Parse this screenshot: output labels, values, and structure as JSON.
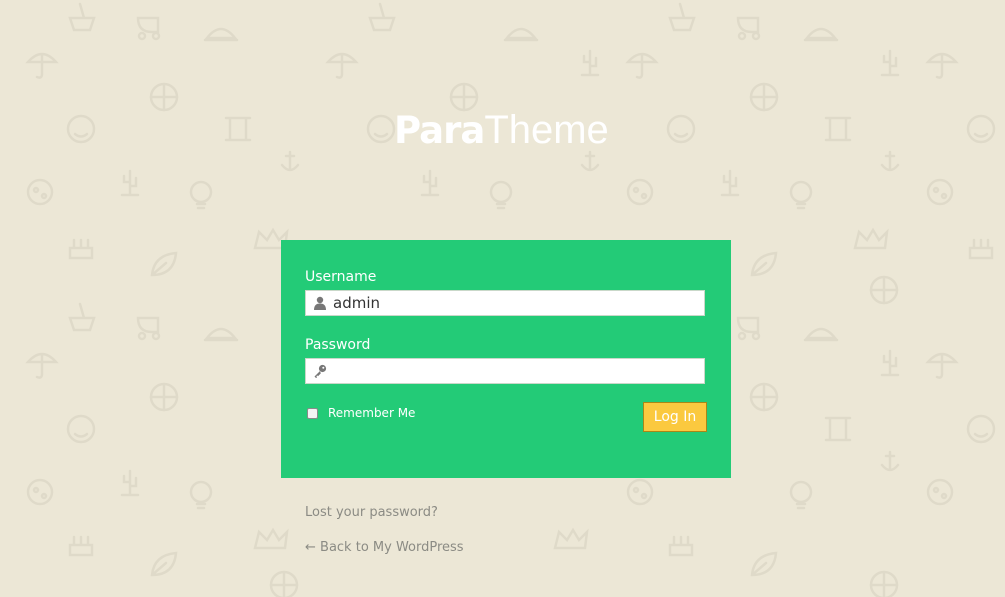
{
  "logo": {
    "part1": "Para",
    "part2": "Theme"
  },
  "form": {
    "username_label": "Username",
    "username_value": "admin",
    "password_label": "Password",
    "password_value": "",
    "remember_label": "Remember Me",
    "remember_checked": false,
    "submit_label": "Log In"
  },
  "links": {
    "lost_password": "Lost your password?",
    "back_to_site": "← Back to My WordPress"
  },
  "icons": {
    "username": "user-icon",
    "password": "key-icon",
    "background": "doodle-pattern"
  },
  "colors": {
    "background": "#ece7d6",
    "panel": "#23cb77",
    "button": "#fbc93f",
    "link": "#8b8b84"
  }
}
